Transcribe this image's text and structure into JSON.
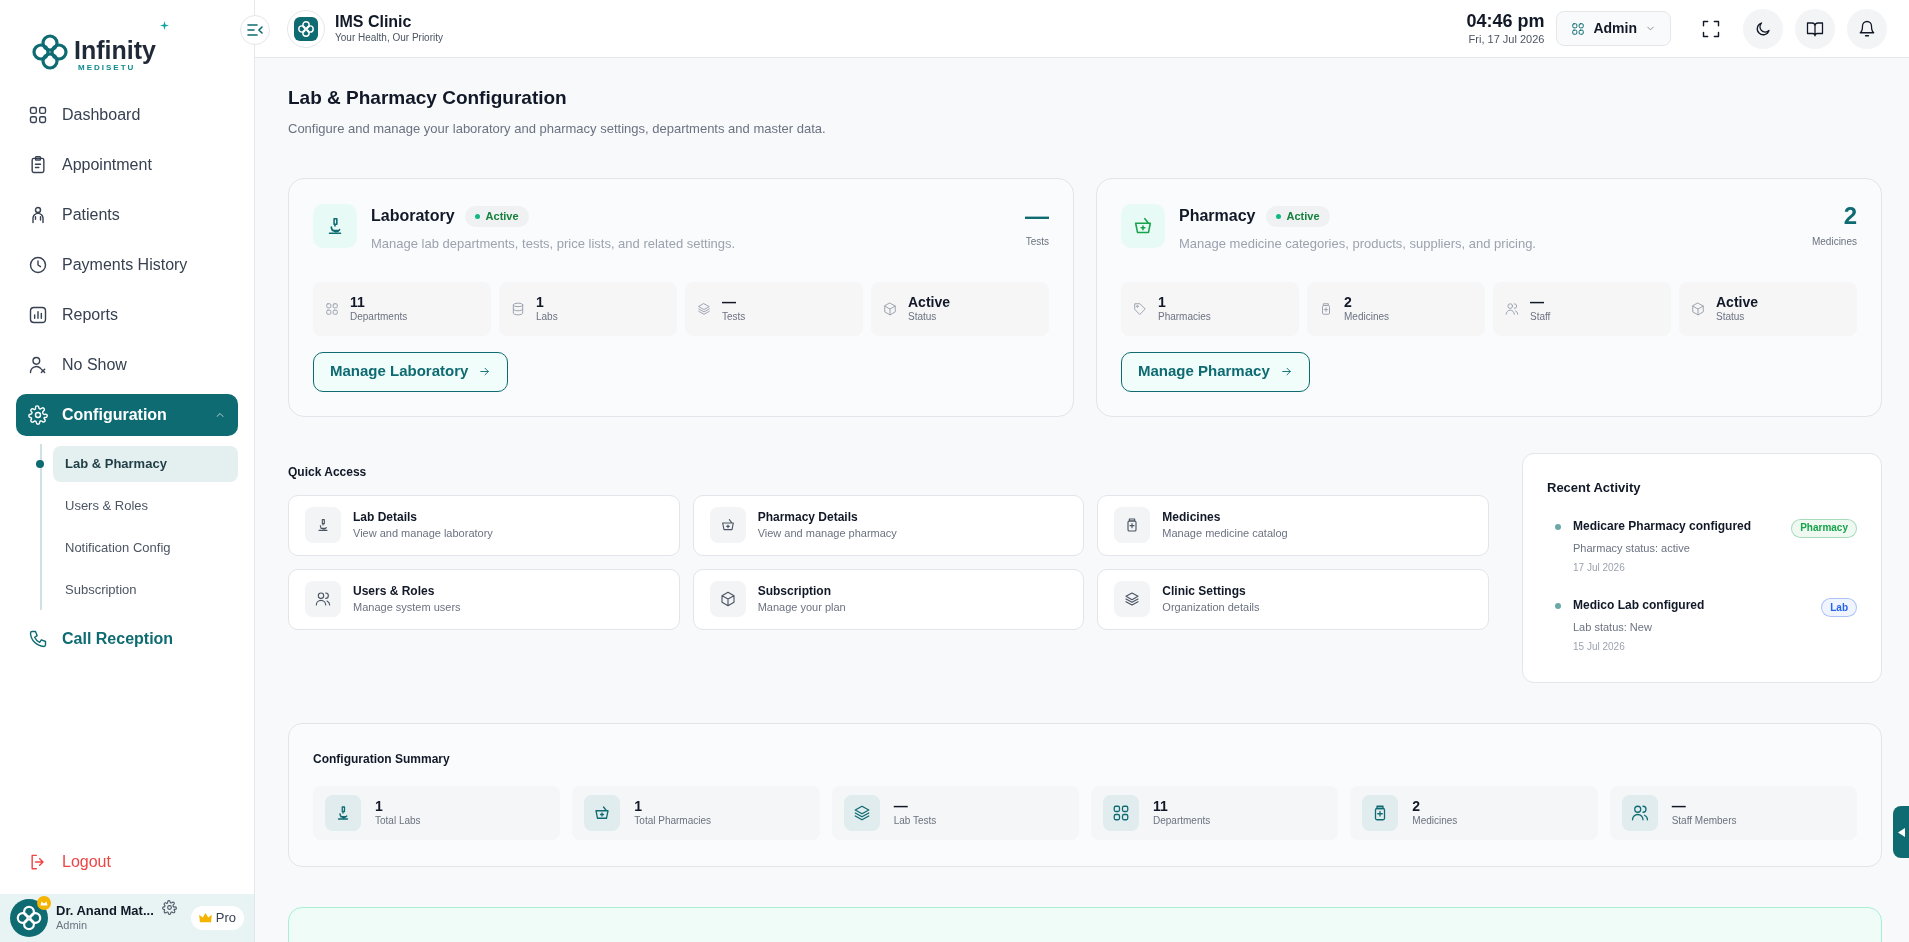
{
  "sidebar": {
    "logo": {
      "name": "Infinity",
      "tagline": "MEDISETU"
    },
    "nav": [
      {
        "label": "Dashboard",
        "selected": false
      },
      {
        "label": "Appointment",
        "selected": false
      },
      {
        "label": "Patients",
        "selected": false
      },
      {
        "label": "Payments History",
        "selected": false
      },
      {
        "label": "Reports",
        "selected": false
      },
      {
        "label": "No Show",
        "selected": false
      },
      {
        "label": "Configuration",
        "selected": true,
        "expanded": true,
        "children": [
          {
            "label": "Lab & Pharmacy",
            "selected": true
          },
          {
            "label": "Users & Roles",
            "selected": false
          },
          {
            "label": "Notification Config",
            "selected": false
          },
          {
            "label": "Subscription",
            "selected": false
          }
        ]
      },
      {
        "label": "Call Reception",
        "selected": false
      }
    ],
    "logout": "Logout",
    "user": {
      "name": "Dr. Anand Mat...",
      "role": "Admin",
      "plan": "Pro"
    }
  },
  "header": {
    "title": "IMS Clinic",
    "subtitle": "Your Health, Our Priority",
    "time": "04:46 pm",
    "date": "Fri, 17 Jul 2026",
    "role_menu": "Admin"
  },
  "page": {
    "title": "Lab & Pharmacy Configuration",
    "subtitle": "Configure and manage your laboratory and pharmacy settings, departments and master data."
  },
  "modules": [
    {
      "title": "Laboratory",
      "status": "Active",
      "description": "Manage lab departments, tests, price lists, and related settings.",
      "headline": "—",
      "headline_label": "Tests",
      "stats": [
        {
          "value": "11",
          "label": "Departments"
        },
        {
          "value": "1",
          "label": "Labs"
        },
        {
          "value": "—",
          "label": "Tests"
        },
        {
          "value": "Active",
          "label": "Status"
        }
      ],
      "button": "Manage Laboratory"
    },
    {
      "title": "Pharmacy",
      "status": "Active",
      "description": "Manage medicine categories, products, suppliers, and pricing.",
      "headline": "2",
      "headline_label": "Medicines",
      "stats": [
        {
          "value": "1",
          "label": "Pharmacies"
        },
        {
          "value": "2",
          "label": "Medicines"
        },
        {
          "value": "—",
          "label": "Staff"
        },
        {
          "value": "Active",
          "label": "Status"
        }
      ],
      "button": "Manage Pharmacy"
    }
  ],
  "quick_access": {
    "title": "Quick Access",
    "items": [
      {
        "title": "Lab Details",
        "subtitle": "View and manage laboratory"
      },
      {
        "title": "Pharmacy Details",
        "subtitle": "View and manage pharmacy"
      },
      {
        "title": "Medicines",
        "subtitle": "Manage medicine catalog"
      },
      {
        "title": "Users & Roles",
        "subtitle": "Manage system users"
      },
      {
        "title": "Subscription",
        "subtitle": "Manage your plan"
      },
      {
        "title": "Clinic Settings",
        "subtitle": "Organization details"
      }
    ]
  },
  "recent_activity": {
    "title": "Recent Activity",
    "items": [
      {
        "title": "Medicare Pharmacy configured",
        "detail": "Pharmacy status: active",
        "date": "17 Jul 2026",
        "tag": "Pharmacy",
        "color": "#16a34a"
      },
      {
        "title": "Medico Lab configured",
        "detail": "Lab status: New",
        "date": "15 Jul 2026",
        "tag": "Lab",
        "color": "#2563eb"
      }
    ]
  },
  "summary": {
    "title": "Configuration Summary",
    "items": [
      {
        "value": "1",
        "label": "Total Labs"
      },
      {
        "value": "1",
        "label": "Total Pharmacies"
      },
      {
        "value": "—",
        "label": "Lab Tests"
      },
      {
        "value": "11",
        "label": "Departments"
      },
      {
        "value": "2",
        "label": "Medicines"
      },
      {
        "value": "—",
        "label": "Staff Members"
      }
    ]
  }
}
